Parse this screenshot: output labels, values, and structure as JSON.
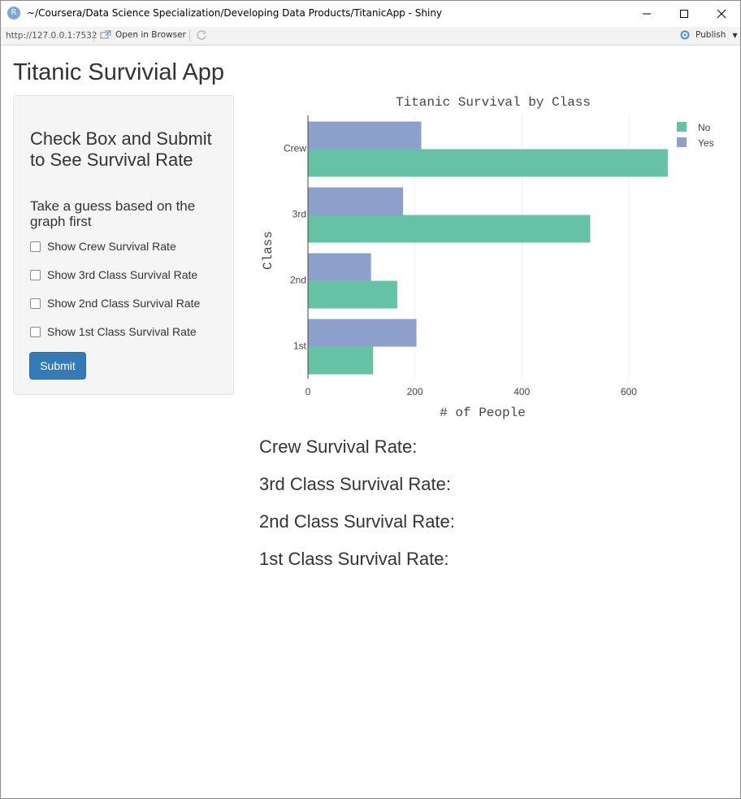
{
  "window": {
    "title": "~/Coursera/Data Science Specialization/Developing Data Products/TitanicApp - Shiny",
    "logo_letter": "R"
  },
  "toolbar": {
    "url": "http://127.0.0.1:7532",
    "open_in_browser": "Open in Browser",
    "publish": "Publish"
  },
  "app": {
    "title": "Titanic Survivial App"
  },
  "sidebar": {
    "heading": "Check Box and Submit to See Survival Rate",
    "subheading": "Take a guess based on the graph first",
    "checkboxes": [
      {
        "label": "Show Crew Survival Rate",
        "checked": false
      },
      {
        "label": "Show 3rd Class Survival Rate",
        "checked": false
      },
      {
        "label": "Show 2nd Class Survival Rate",
        "checked": false
      },
      {
        "label": "Show 1st Class Survival Rate",
        "checked": false
      }
    ],
    "submit_label": "Submit"
  },
  "chart_data": {
    "type": "bar",
    "orientation": "horizontal",
    "title": "Titanic Survival by Class",
    "xlabel": "# of People",
    "ylabel": "Class",
    "categories": [
      "Crew",
      "3rd",
      "2nd",
      "1st"
    ],
    "series": [
      {
        "name": "No",
        "color": "#66c2a5",
        "values": [
          673,
          528,
          167,
          122
        ]
      },
      {
        "name": "Yes",
        "color": "#8da0cb",
        "values": [
          212,
          178,
          118,
          203
        ]
      }
    ],
    "xlim": [
      0,
      740
    ],
    "xticks": [
      0,
      200,
      400,
      600
    ],
    "legend_position": "top-right",
    "grid": true
  },
  "rates": [
    {
      "label": "Crew Survival Rate:"
    },
    {
      "label": "3rd Class Survival Rate:"
    },
    {
      "label": "2nd Class Survival Rate:"
    },
    {
      "label": "1st Class Survival Rate:"
    }
  ]
}
